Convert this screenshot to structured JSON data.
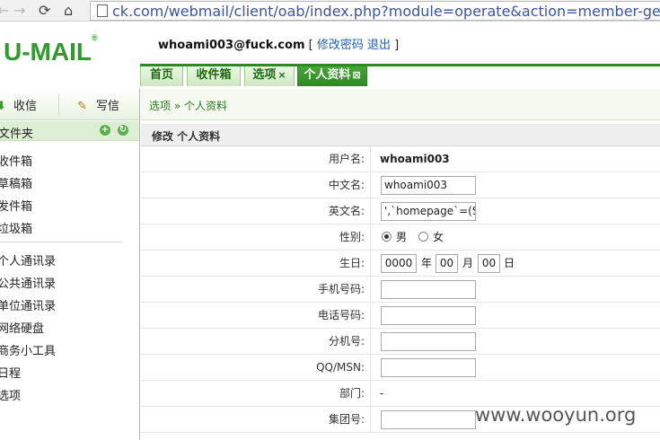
{
  "browser": {
    "back_icon": "back-arrow-icon",
    "forward_icon": "forward-arrow-icon",
    "reload_icon": "reload-icon",
    "home_icon": "home-icon",
    "url": "ck.com/webmail/client/oab/index.php?module=operate&action=member-get&page="
  },
  "header": {
    "logo": "U-MAIL",
    "logo_mark": "®",
    "user_email": "whoami003@fuck.com",
    "change_password": "修改密码",
    "logout": "退出",
    "tabs": [
      {
        "label": "首页"
      },
      {
        "label": "收件箱"
      },
      {
        "label": "选项",
        "close": "×"
      },
      {
        "label": "个人资料",
        "close": "⊠"
      }
    ]
  },
  "sidebar": {
    "receive": "收信",
    "compose": "写信",
    "folders_label": "文件夹",
    "folders": [
      "收件箱",
      "草稿箱",
      "发件箱",
      "垃圾箱"
    ],
    "tools": [
      "个人通讯录",
      "公共通讯录",
      "单位通讯录",
      "网络硬盘",
      "商务小工具",
      "日程",
      "选项"
    ]
  },
  "main": {
    "breadcrumb": "选项 » 个人资料",
    "section_title": "修改 个人资料",
    "form": {
      "username_label": "用户名:",
      "username": "whoami003",
      "cn_name_label": "中文名:",
      "cn_name": "whoami003",
      "en_name_label": "英文名:",
      "en_name": "',`homepage`=(SI",
      "gender_label": "性别:",
      "gender_male": "男",
      "gender_female": "女",
      "birthday_label": "生日:",
      "birth_year": "0000",
      "year_unit": "年",
      "birth_month": "00",
      "month_unit": "月",
      "birth_day": "00",
      "day_unit": "日",
      "mobile_label": "手机号码:",
      "phone_label": "电话号码:",
      "ext_label": "分机号:",
      "qq_label": "QQ/MSN:",
      "dept_label": "部门:",
      "dept": "-",
      "group_label": "集团号:"
    }
  },
  "watermark": "www.wooyun.org"
}
